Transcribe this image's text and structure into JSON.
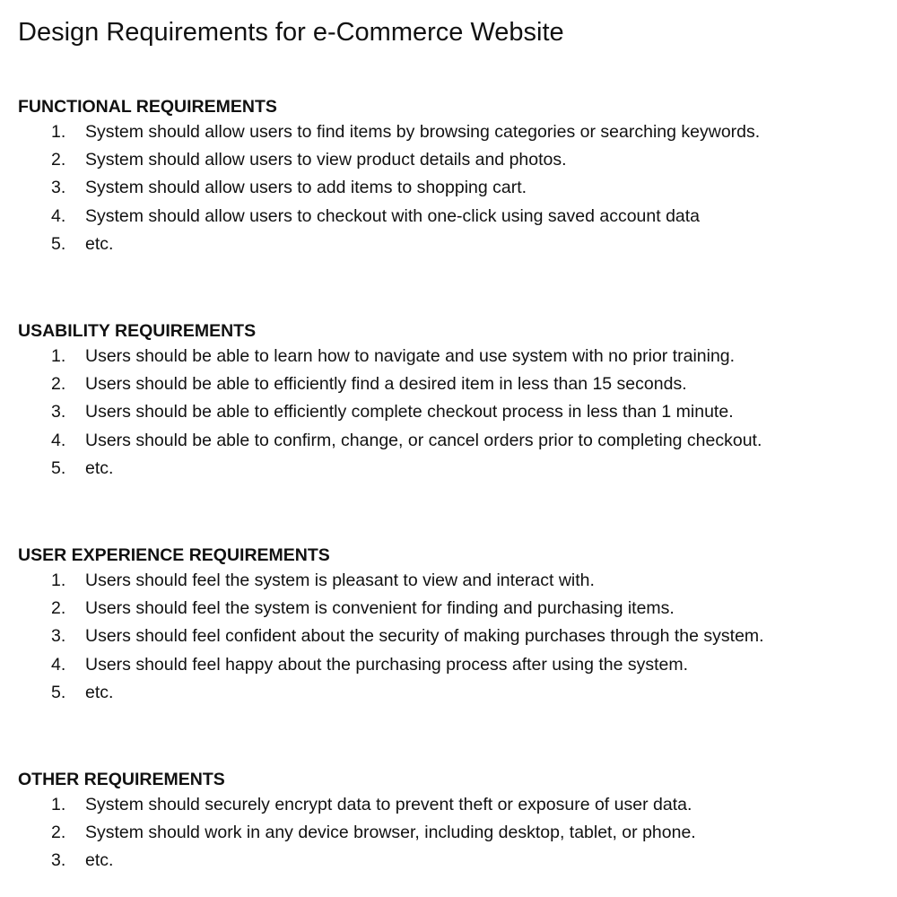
{
  "title": "Design Requirements for e-Commerce Website",
  "sections": [
    {
      "heading": "FUNCTIONAL REQUIREMENTS",
      "items": [
        {
          "num": "1.",
          "text": "System should allow users to find items by browsing categories or searching keywords."
        },
        {
          "num": "2.",
          "text": "System should allow users to view product details and photos."
        },
        {
          "num": "3.",
          "text": "System should allow users to add items to shopping cart."
        },
        {
          "num": "4.",
          "text": "System should allow users to checkout with one-click using saved account data"
        },
        {
          "num": "5.",
          "text": "etc."
        }
      ]
    },
    {
      "heading": "USABILITY REQUIREMENTS",
      "items": [
        {
          "num": "1.",
          "text": "Users should be able to learn how to navigate and use system with no prior training."
        },
        {
          "num": "2.",
          "text": "Users should be able to efficiently find a desired item in less than 15 seconds."
        },
        {
          "num": "3.",
          "text": "Users should be able to efficiently complete checkout process in less than 1 minute."
        },
        {
          "num": "4.",
          "text": "Users should be able to confirm, change, or cancel orders prior to completing checkout."
        },
        {
          "num": "5.",
          "text": "etc."
        }
      ]
    },
    {
      "heading": "USER EXPERIENCE REQUIREMENTS",
      "items": [
        {
          "num": "1.",
          "text": "Users should feel the system is pleasant to view and interact with."
        },
        {
          "num": "2.",
          "text": "Users should feel the system is convenient for finding and purchasing items."
        },
        {
          "num": "3.",
          "text": "Users should feel confident about the security of making purchases through the system."
        },
        {
          "num": "4.",
          "text": "Users should feel happy about the purchasing process after using the system."
        },
        {
          "num": "5.",
          "text": "etc."
        }
      ]
    },
    {
      "heading": "OTHER REQUIREMENTS",
      "items": [
        {
          "num": "1.",
          "text": "System should securely encrypt data to prevent theft or exposure of user data."
        },
        {
          "num": "2.",
          "text": "System should work in any device browser, including desktop, tablet, or phone."
        },
        {
          "num": "3.",
          "text": "etc."
        }
      ]
    }
  ]
}
